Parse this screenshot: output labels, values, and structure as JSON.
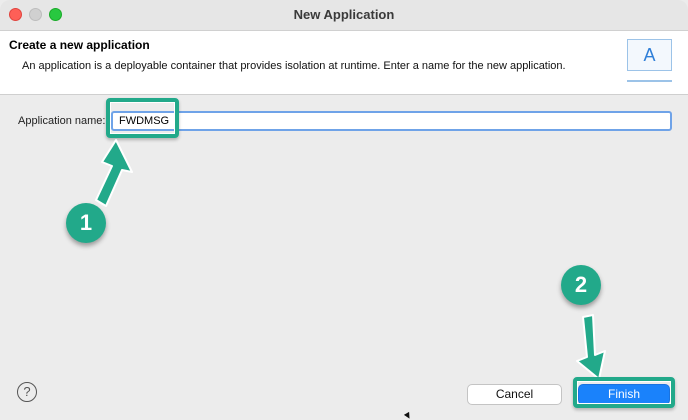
{
  "window": {
    "title": "New Application"
  },
  "banner": {
    "title": "Create a new application",
    "description": "An application is a deployable container that provides isolation at runtime. Enter a name for the new application.",
    "icon_letter": "A"
  },
  "form": {
    "name_label": "Application name:",
    "name_value": "FWDMSG"
  },
  "annotations": {
    "step1": "1",
    "step2": "2",
    "accent_color": "#22a98a"
  },
  "footer": {
    "help_glyph": "?",
    "cancel_label": "Cancel",
    "finish_label": "Finish"
  }
}
